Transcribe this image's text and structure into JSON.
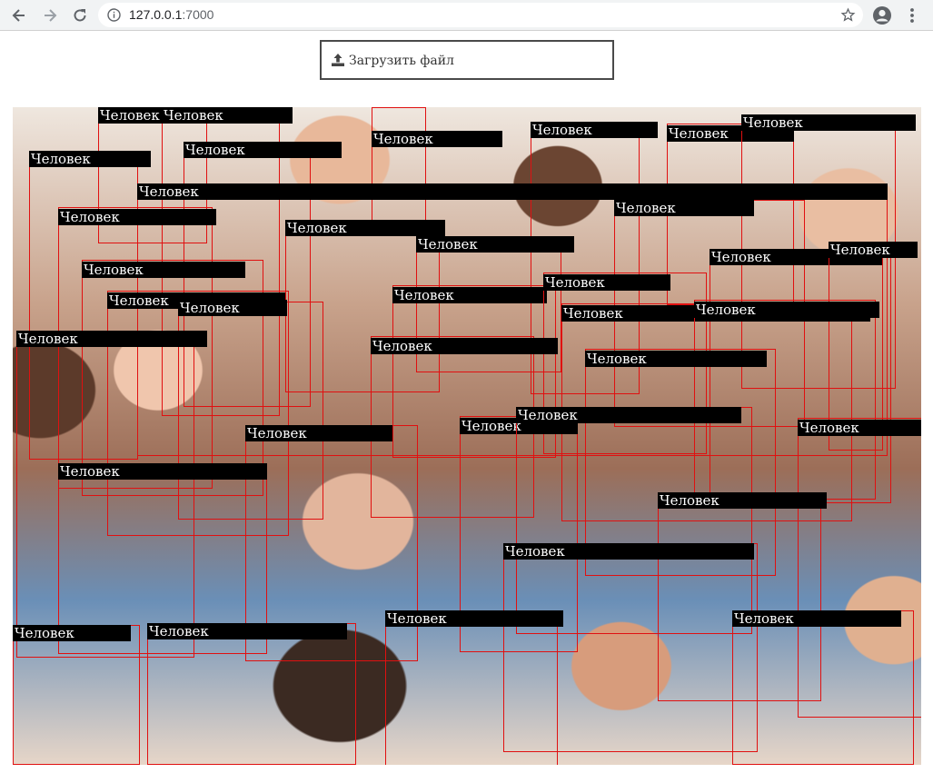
{
  "browser": {
    "url_host": "127.0.0.1",
    "url_port": ":7000"
  },
  "upload": {
    "label": "Загрузить файл"
  },
  "detections": {
    "class_label": "Человек",
    "count": 36
  },
  "colors": {
    "box": "#e01010",
    "label_bg": "#000000",
    "label_text": "#ffffff"
  }
}
